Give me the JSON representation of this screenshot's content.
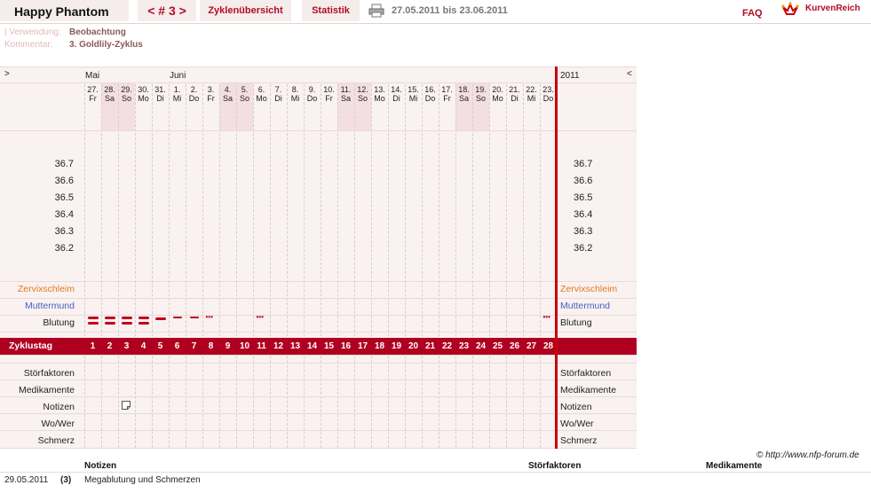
{
  "header": {
    "app_title": "Happy Phantom",
    "cycle_nav": "< # 3 >",
    "tab_overview": "Zyklenübersicht",
    "tab_stats": "Statistik",
    "date_range": "27.05.2011 bis 23.06.2011",
    "faq": "FAQ",
    "brand": "KurvenReich"
  },
  "meta": {
    "usage_label": "| Verwendung:",
    "usage_value": "Beobachtung",
    "comment_label": "Kommentar:",
    "comment_value": "3. Goldlily-Zyklus"
  },
  "chart": {
    "nav_left": ">",
    "nav_right": "<",
    "month_may": "Mai",
    "month_june": "Juni",
    "year": "2011",
    "days": [
      {
        "d": "27.",
        "w": "Fr"
      },
      {
        "d": "28.",
        "w": "Sa"
      },
      {
        "d": "29.",
        "w": "So"
      },
      {
        "d": "30.",
        "w": "Mo"
      },
      {
        "d": "31.",
        "w": "Di"
      },
      {
        "d": "1.",
        "w": "Mi"
      },
      {
        "d": "2.",
        "w": "Do"
      },
      {
        "d": "3.",
        "w": "Fr"
      },
      {
        "d": "4.",
        "w": "Sa"
      },
      {
        "d": "5.",
        "w": "So"
      },
      {
        "d": "6.",
        "w": "Mo"
      },
      {
        "d": "7.",
        "w": "Di"
      },
      {
        "d": "8.",
        "w": "Mi"
      },
      {
        "d": "9.",
        "w": "Do"
      },
      {
        "d": "10.",
        "w": "Fr"
      },
      {
        "d": "11.",
        "w": "Sa"
      },
      {
        "d": "12.",
        "w": "So"
      },
      {
        "d": "13.",
        "w": "Mo"
      },
      {
        "d": "14.",
        "w": "Di"
      },
      {
        "d": "15.",
        "w": "Mi"
      },
      {
        "d": "16.",
        "w": "Do"
      },
      {
        "d": "17.",
        "w": "Fr"
      },
      {
        "d": "18.",
        "w": "Sa"
      },
      {
        "d": "19.",
        "w": "So"
      },
      {
        "d": "20.",
        "w": "Mo"
      },
      {
        "d": "21.",
        "w": "Di"
      },
      {
        "d": "22.",
        "w": "Mi"
      },
      {
        "d": "23.",
        "w": "Do"
      }
    ],
    "temp_labels": [
      "36.7",
      "36.6",
      "36.5",
      "36.4",
      "36.3",
      "36.2"
    ],
    "rows": {
      "cervix": "Zervixschleim",
      "cervix_pos": "Muttermund",
      "bleeding": "Blutung",
      "cycle_day": "Zyklustag",
      "disturbances": "Störfaktoren",
      "medication": "Medikamente",
      "notes": "Notizen",
      "where_who": "Wo/Wer",
      "pain": "Schmerz"
    },
    "cycle_days": [
      "1",
      "2",
      "3",
      "4",
      "5",
      "6",
      "7",
      "8",
      "9",
      "10",
      "11",
      "12",
      "13",
      "14",
      "15",
      "16",
      "17",
      "18",
      "19",
      "20",
      "21",
      "22",
      "23",
      "24",
      "25",
      "26",
      "27",
      "28"
    ],
    "bleeding_by_day": [
      "heavy",
      "heavy",
      "heavy",
      "heavy",
      "medium",
      "light",
      "light",
      "spotting",
      "",
      "",
      "spotting",
      "",
      "",
      "",
      "",
      "",
      "",
      "",
      "",
      "",
      "",
      "",
      "",
      "",
      "",
      "",
      "",
      "spotting"
    ],
    "note_on_day": 3
  },
  "copyright": "© http://www.nfp-forum.de",
  "notes_table": {
    "headers": {
      "notes": "Notizen",
      "disturbances": "Störfaktoren",
      "medication": "Medikamente"
    },
    "rows": [
      {
        "date": "29.05.2011",
        "day": "(3)",
        "note": "Megablutung und Schmerzen"
      }
    ]
  },
  "colors": {
    "accent": "#b00020",
    "cervix": "#e27b1e",
    "cervix_pos": "#4b5fbf"
  }
}
